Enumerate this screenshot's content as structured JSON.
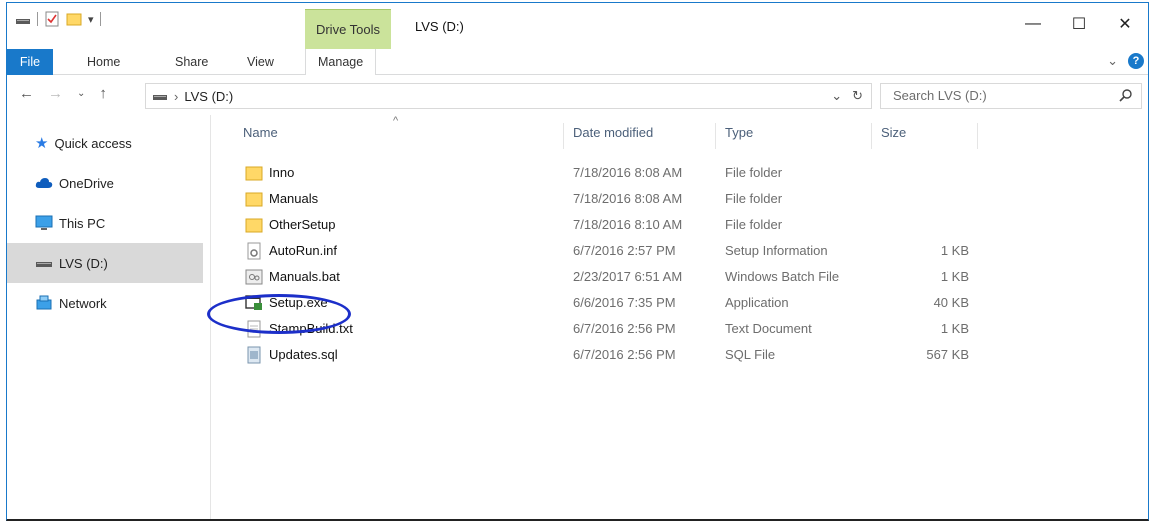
{
  "window": {
    "title": "LVS (D:)",
    "context_tab": "Drive Tools",
    "controls": {
      "minimize": "—",
      "maximize": "☐",
      "close": "✕"
    }
  },
  "ribbon": {
    "tabs": [
      "File",
      "Home",
      "Share",
      "View",
      "Manage"
    ],
    "collapse": "⌄",
    "help": "?"
  },
  "address": {
    "path_separator": "›",
    "location": "LVS (D:)",
    "search_placeholder": "Search LVS (D:)"
  },
  "navpane": [
    {
      "label": "Quick access",
      "icon": "star-icon"
    },
    {
      "label": "OneDrive",
      "icon": "cloud-icon"
    },
    {
      "label": "This PC",
      "icon": "computer-icon"
    },
    {
      "label": "LVS (D:)",
      "icon": "drive-icon",
      "selected": true
    },
    {
      "label": "Network",
      "icon": "network-icon"
    }
  ],
  "columns": {
    "name": "Name",
    "date": "Date modified",
    "type": "Type",
    "size": "Size"
  },
  "files": [
    {
      "name": "Inno",
      "date": "7/18/2016 8:08 AM",
      "type": "File folder",
      "size": "",
      "icon": "folder-icon"
    },
    {
      "name": "Manuals",
      "date": "7/18/2016 8:08 AM",
      "type": "File folder",
      "size": "",
      "icon": "folder-icon"
    },
    {
      "name": "OtherSetup",
      "date": "7/18/2016 8:10 AM",
      "type": "File folder",
      "size": "",
      "icon": "folder-icon"
    },
    {
      "name": "AutoRun.inf",
      "date": "6/7/2016 2:57 PM",
      "type": "Setup Information",
      "size": "1 KB",
      "icon": "settings-file-icon"
    },
    {
      "name": "Manuals.bat",
      "date": "2/23/2017 6:51 AM",
      "type": "Windows Batch File",
      "size": "1 KB",
      "icon": "batch-file-icon"
    },
    {
      "name": "Setup.exe",
      "date": "6/6/2016 7:35 PM",
      "type": "Application",
      "size": "40 KB",
      "icon": "application-icon"
    },
    {
      "name": "StampBuild.txt",
      "date": "6/7/2016 2:56 PM",
      "type": "Text Document",
      "size": "1 KB",
      "icon": "text-file-icon"
    },
    {
      "name": "Updates.sql",
      "date": "6/7/2016 2:56 PM",
      "type": "SQL File",
      "size": "567 KB",
      "icon": "sql-file-icon"
    }
  ],
  "colors": {
    "accent": "#1979ca",
    "drive_tools_tab": "#cbe39b",
    "folder": "#ffd867",
    "callout": "#1c2fc9"
  }
}
